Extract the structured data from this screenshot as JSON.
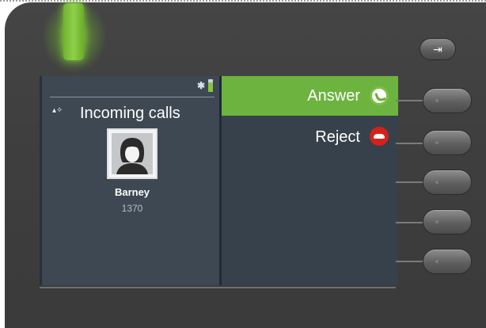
{
  "status": {
    "bluetooth_icon": "bluetooth-icon",
    "battery_icon": "battery-icon",
    "battery_color": "#88c440"
  },
  "call": {
    "title": "Incoming calls",
    "caller_name": "Barney",
    "caller_number": "1370"
  },
  "options": [
    {
      "label": "Answer",
      "icon": "phone-answer-icon",
      "selected": true
    },
    {
      "label": "Reject",
      "icon": "phone-reject-icon",
      "selected": false
    }
  ],
  "colors": {
    "selection": "#6db33f",
    "reject": "#d4221a",
    "led": "#8fd04a"
  },
  "hardware": {
    "exit_key_glyph": "⇥",
    "softkey_count": 5
  }
}
